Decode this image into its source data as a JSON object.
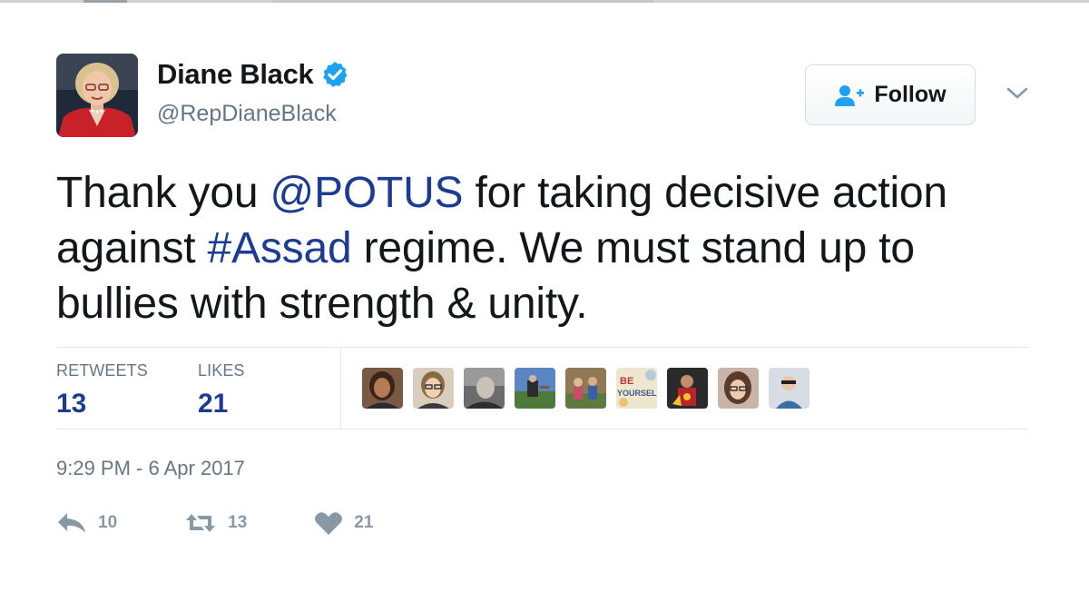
{
  "author": {
    "display_name": "Diane Black",
    "handle": "@RepDianeBlack",
    "verified_icon": "verified-badge-icon",
    "avatar_icon": "profile-photo"
  },
  "follow_button": {
    "label": "Follow",
    "icon": "add-user-icon"
  },
  "menu": {
    "icon": "chevron-down-icon"
  },
  "tweet": {
    "segments": [
      {
        "text": "Thank you ",
        "type": "text"
      },
      {
        "text": "@POTUS",
        "type": "mention"
      },
      {
        "text": " for taking decisive action against ",
        "type": "text"
      },
      {
        "text": "#Assad",
        "type": "hashtag"
      },
      {
        "text": " regime. We must stand up to bullies with strength & unity.",
        "type": "text"
      }
    ]
  },
  "stats": {
    "retweets_label": "RETWEETS",
    "retweets_count": "13",
    "likes_label": "LIKES",
    "likes_count": "21"
  },
  "likers": {
    "count_shown": 9,
    "tile_text": [
      "BE",
      "YOURSELF"
    ]
  },
  "timestamp": "9:29 PM - 6 Apr 2017",
  "actions": {
    "reply_count": "10",
    "retweet_count": "13",
    "like_count": "21"
  },
  "colors": {
    "link": "#1b3c91",
    "verified": "#1da1f2",
    "muted": "#657786",
    "action_icon": "#8899a6"
  }
}
